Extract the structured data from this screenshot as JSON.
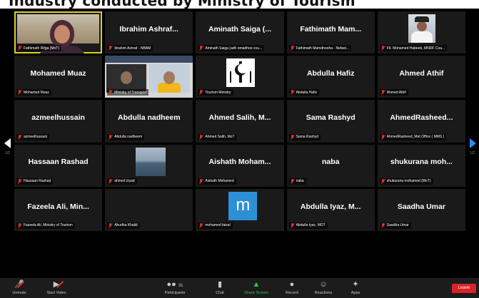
{
  "caption": "Industry conducted by Ministry of Tourism",
  "meeting": {
    "tiles": [
      {
        "name": "",
        "label": "Fathimath Rifga (MoT)"
      },
      {
        "name": "Ibrahim Ashraf...",
        "label": "Ibrahim Ashraf - NBAM"
      },
      {
        "name": "Aminath Saiga (...",
        "label": "Aminath Saiga (adh omadhoo cou..."
      },
      {
        "name": "Fathimath Mam...",
        "label": "Fathimath Mamdhooha - Nefast..."
      },
      {
        "name": "",
        "label": "Flt. Mohamed Habeeb, MNDF Coa..."
      },
      {
        "name": "Mohamed Muaz",
        "label": "Mohamed Muaz"
      },
      {
        "name": "",
        "label": "Ministry of Transport"
      },
      {
        "name": "",
        "label": "Tourism Ministry"
      },
      {
        "name": "Abdulla Hafiz",
        "label": "Abdulla Hafiz"
      },
      {
        "name": "Ahmed Athif",
        "label": "Ahmed Athif"
      },
      {
        "name": "azmeelhussain",
        "label": "azmeelhussain"
      },
      {
        "name": "Abdulla nadheem",
        "label": "Abdulla nadheem"
      },
      {
        "name": "Ahmed Salih, M...",
        "label": "Ahmed Salih, MoT"
      },
      {
        "name": "Sama Rashyd",
        "label": "Sama Rashyd"
      },
      {
        "name": "AhmedRasheed...",
        "label": "AhmedRasheed_Met Office ( MMS )"
      },
      {
        "name": "Hassaan Rashad",
        "label": "Hassaan Rashad"
      },
      {
        "name": "",
        "label": "ahmed ziyad"
      },
      {
        "name": "Aishath Moham...",
        "label": "Aishath Mohamed"
      },
      {
        "name": "naba",
        "label": "naba"
      },
      {
        "name": "shukurana moh...",
        "label": "shukurana mohamed (MoT)"
      },
      {
        "name": "Fazeela Ali, Min...",
        "label": "Fazeela Ali, Ministry of Tourism"
      },
      {
        "name": "",
        "label": "Ahudha Khalid"
      },
      {
        "name": "",
        "label": "mohamed faisal"
      },
      {
        "name": "Abdulla Iyaz, M...",
        "label": "Abdulla Iyaz, MOT"
      },
      {
        "name": "Saadha Umar",
        "label": "Saadha Umar"
      }
    ],
    "avatar_letter": "m",
    "pager_left": "1/2",
    "pager_right": "1/2"
  },
  "toolbar": {
    "unmute": "Unmute",
    "start_video": "Start Video",
    "participants": "Participants",
    "participants_count": "31",
    "chat": "Chat",
    "share_screen": "Share Screen",
    "record": "Record",
    "reactions": "Reactions",
    "apps": "Apps",
    "leave": "Leave"
  },
  "colors": {
    "active_speaker": "#d6d226",
    "share_green": "#33c45a",
    "leave_red": "#d8232a",
    "muted_red": "#e0302a",
    "nav_blue": "#2d8cff"
  }
}
